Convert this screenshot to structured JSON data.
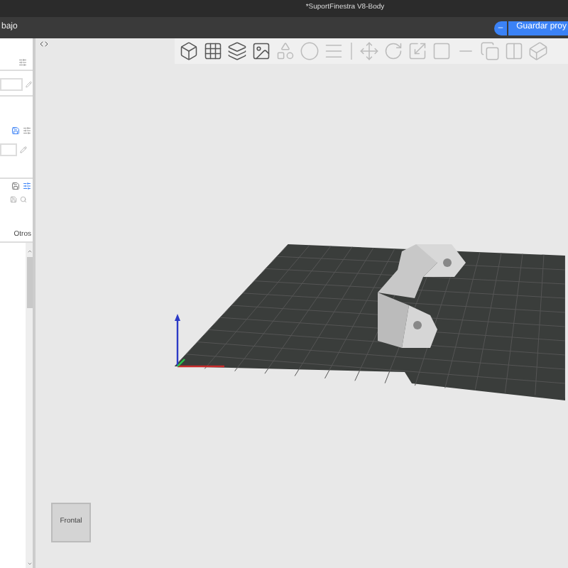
{
  "window": {
    "title": "*SuportFinestra V8-Body"
  },
  "menu_bar": {
    "tab_label": "bajo",
    "save_button": "Guardar proy"
  },
  "sidebar": {
    "tab_label": "Otros"
  },
  "view_cube": {
    "face_label": "Frontal"
  }
}
